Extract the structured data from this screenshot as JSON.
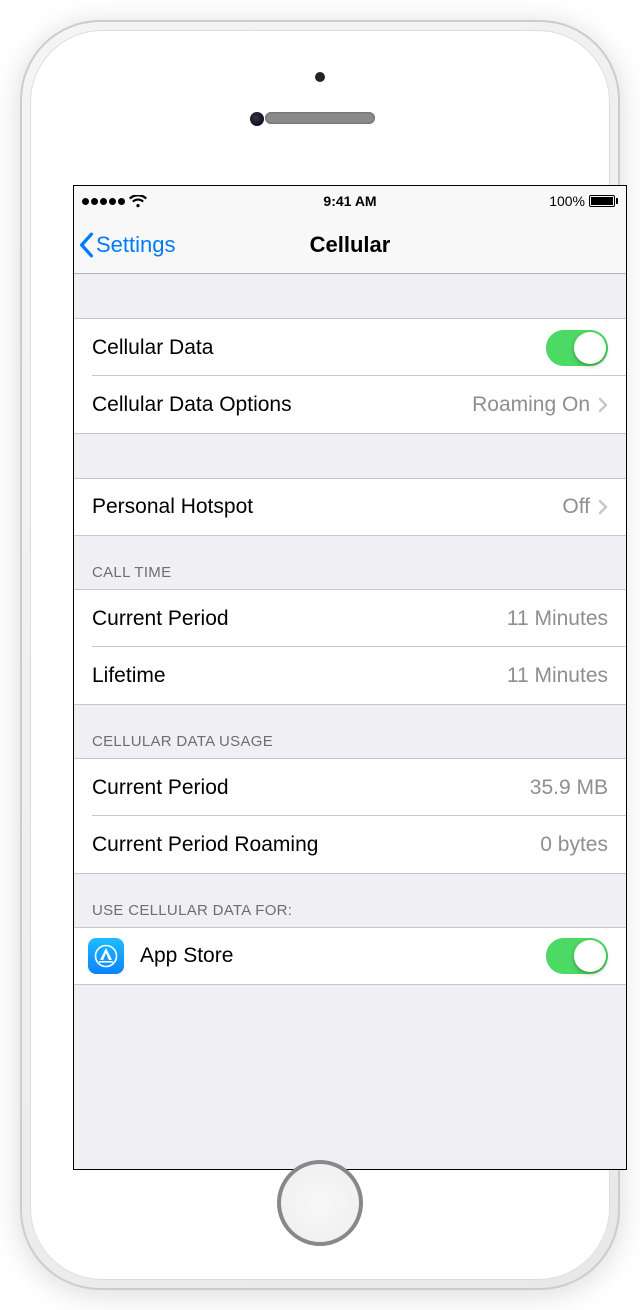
{
  "status_bar": {
    "time": "9:41 AM",
    "battery_pct": "100%"
  },
  "nav": {
    "back_label": "Settings",
    "title": "Cellular"
  },
  "sections": {
    "main": {
      "cellular_data_label": "Cellular Data",
      "cellular_data_on": true,
      "cellular_data_options_label": "Cellular Data Options",
      "cellular_data_options_value": "Roaming On"
    },
    "hotspot": {
      "label": "Personal Hotspot",
      "value": "Off"
    },
    "call_time": {
      "header": "CALL TIME",
      "current_period_label": "Current Period",
      "current_period_value": "11 Minutes",
      "lifetime_label": "Lifetime",
      "lifetime_value": "11 Minutes"
    },
    "data_usage": {
      "header": "CELLULAR DATA USAGE",
      "current_period_label": "Current Period",
      "current_period_value": "35.9 MB",
      "roaming_label": "Current Period Roaming",
      "roaming_value": "0 bytes"
    },
    "use_for": {
      "header": "USE CELLULAR DATA FOR:",
      "app_store_label": "App Store",
      "app_store_on": true
    }
  }
}
